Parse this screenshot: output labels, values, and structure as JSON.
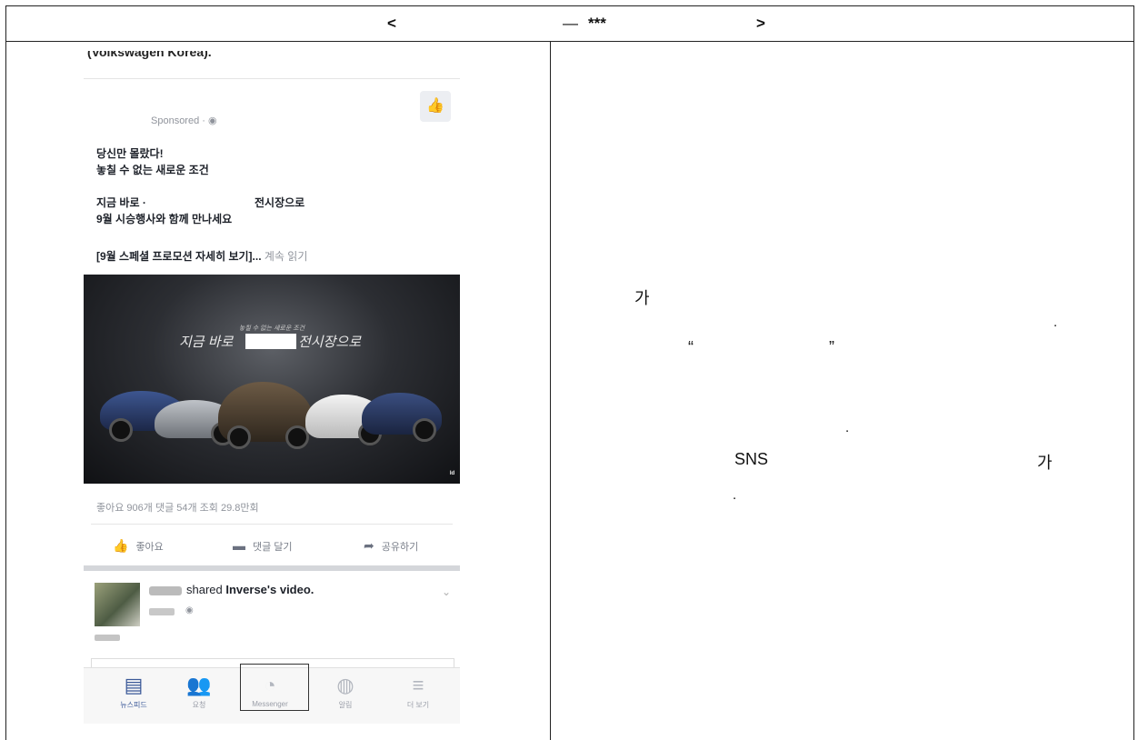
{
  "header": {
    "left_bracket": "<",
    "dash": "—",
    "stars": "***",
    "right_bracket": ">"
  },
  "ad_post": {
    "prev_post_tail": "(Volkswagen Korea).",
    "sponsored_label": "Sponsored · ",
    "line1": "당신만 몰랐다!",
    "line2": "놓칠 수 없는 새로운 조건",
    "line3a": "지금 바로 ·",
    "line3b": "전시장으로",
    "line4": "9월 시승행사와 함께 만나세요",
    "line5": "[9월 스페셜 프로모션 자세히 보기]...",
    "more_label": "계속 읽기",
    "image_small_text": "놓칠 수 없는 새로운 조건",
    "image_headline_a": "지금 바로",
    "image_headline_b": "전시장으로",
    "image_badge": "ᴵᵈ",
    "stats": "좋아요 906개  댓글 54개  조회 29.8만회",
    "actions": [
      {
        "icon": "thumbs-up-icon",
        "glyph": "👍",
        "label": "좋아요"
      },
      {
        "icon": "comment-icon",
        "glyph": "▬",
        "label": "댓글 달기"
      },
      {
        "icon": "share-icon",
        "glyph": "➦",
        "label": "공유하기"
      }
    ]
  },
  "shared_post": {
    "text_prefix": "shared ",
    "text_bold": "Inverse's video.",
    "globe": "◉",
    "chevron": "⌄"
  },
  "tabbar": [
    {
      "label": "뉴스피드",
      "icon": "news-feed-icon",
      "glyph": "▤",
      "active": true
    },
    {
      "label": "요청",
      "icon": "friend-requests-icon",
      "glyph": "👥",
      "active": false
    },
    {
      "label": "Messenger",
      "icon": "messenger-icon",
      "glyph": "◔",
      "active": false
    },
    {
      "label": "알림",
      "icon": "notifications-globe-icon",
      "glyph": "◍",
      "active": false
    },
    {
      "label": "더 보기",
      "icon": "more-menu-icon",
      "glyph": "≡",
      "active": false
    }
  ],
  "right_text": {
    "ga1": "가",
    "period1": ".",
    "quote_open": "“",
    "quote_close": "”",
    "period2": ".",
    "sns": "SNS",
    "ga2": "가",
    "period3": "."
  }
}
